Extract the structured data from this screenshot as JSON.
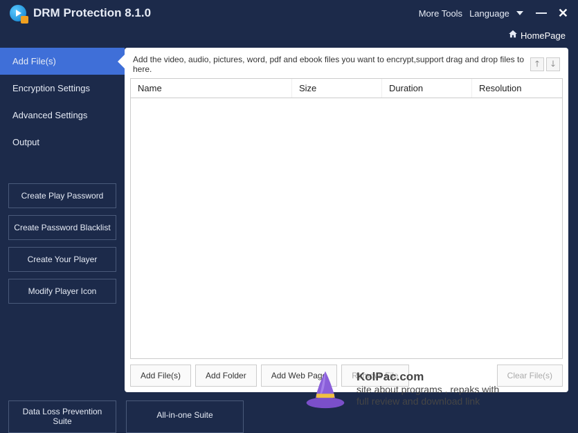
{
  "titlebar": {
    "app_title": "DRM Protection 8.1.0",
    "more_tools": "More Tools",
    "language": "Language"
  },
  "homerow": {
    "label": "HomePage"
  },
  "sidebar": {
    "nav": [
      "Add File(s)",
      "Encryption Settings",
      "Advanced Settings",
      "Output"
    ],
    "buttons": [
      "Create Play Password",
      "Create Password Blacklist",
      "Create Your Player",
      "Modify Player Icon"
    ]
  },
  "main": {
    "hint": "Add the video, audio, pictures, word, pdf and ebook files you want to encrypt,support drag and drop files to here.",
    "columns": {
      "name": "Name",
      "size": "Size",
      "duration": "Duration",
      "resolution": "Resolution"
    },
    "actions": {
      "add_files": "Add File(s)",
      "add_folder": "Add Folder",
      "add_web": "Add Web Page",
      "remove": "Remove File",
      "clear": "Clear File(s)"
    }
  },
  "bottom": {
    "dlp": "Data Loss Prevention Suite",
    "aio": "All-in-one Suite"
  },
  "watermark": {
    "title": "KolPac.com",
    "sub1": "site about programs , repaks with",
    "sub2": "full review and download link"
  }
}
